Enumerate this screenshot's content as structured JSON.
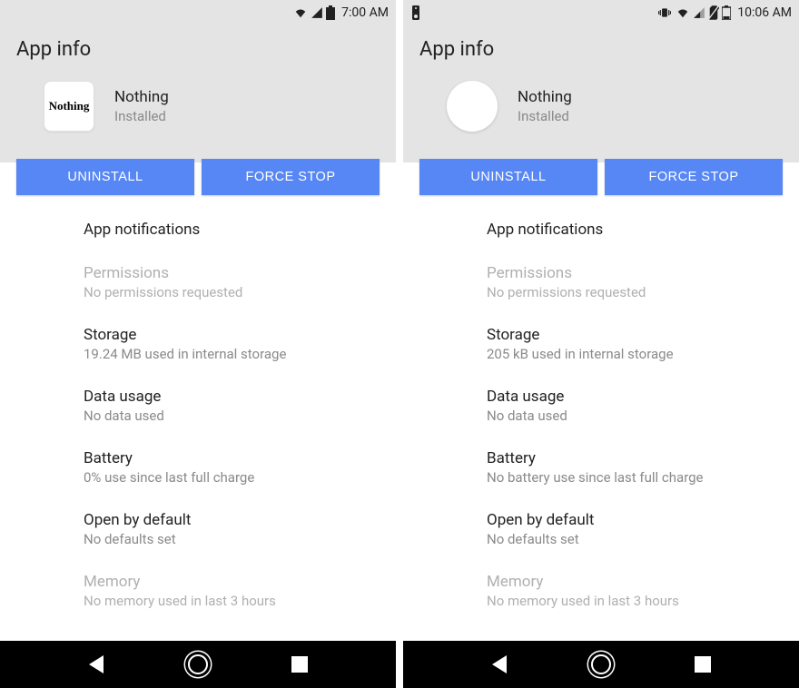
{
  "screens": [
    {
      "status": {
        "time": "7:00 AM",
        "icons": [
          "wifi",
          "cell",
          "battery-full"
        ]
      },
      "header": {
        "title": "App info"
      },
      "app": {
        "name": "Nothing",
        "status": "Installed",
        "icon_style": "square-label",
        "icon_text": "Nothing"
      },
      "buttons": {
        "uninstall": "UNINSTALL",
        "force_stop": "FORCE STOP"
      },
      "items": [
        {
          "title": "App notifications",
          "sub": "",
          "enabled": true
        },
        {
          "title": "Permissions",
          "sub": "No permissions requested",
          "enabled": false
        },
        {
          "title": "Storage",
          "sub": "19.24 MB used in internal storage",
          "enabled": true
        },
        {
          "title": "Data usage",
          "sub": "No data used",
          "enabled": true
        },
        {
          "title": "Battery",
          "sub": "0% use since last full charge",
          "enabled": true
        },
        {
          "title": "Open by default",
          "sub": "No defaults set",
          "enabled": true
        },
        {
          "title": "Memory",
          "sub": "No memory used in last 3 hours",
          "enabled": false
        }
      ]
    },
    {
      "status": {
        "time": "10:06 AM",
        "icons": [
          "speaker",
          "vibrate",
          "wifi",
          "cell",
          "no-sim",
          "battery-low"
        ]
      },
      "header": {
        "title": "App info"
      },
      "app": {
        "name": "Nothing",
        "status": "Installed",
        "icon_style": "circle",
        "icon_text": ""
      },
      "buttons": {
        "uninstall": "UNINSTALL",
        "force_stop": "FORCE STOP"
      },
      "items": [
        {
          "title": "App notifications",
          "sub": "",
          "enabled": true
        },
        {
          "title": "Permissions",
          "sub": "No permissions requested",
          "enabled": false
        },
        {
          "title": "Storage",
          "sub": "205 kB used in internal storage",
          "enabled": true
        },
        {
          "title": "Data usage",
          "sub": "No data used",
          "enabled": true
        },
        {
          "title": "Battery",
          "sub": "No battery use since last full charge",
          "enabled": true
        },
        {
          "title": "Open by default",
          "sub": "No defaults set",
          "enabled": true
        },
        {
          "title": "Memory",
          "sub": "No memory used in last 3 hours",
          "enabled": false
        }
      ]
    }
  ],
  "colors": {
    "accent": "#5787f5"
  }
}
